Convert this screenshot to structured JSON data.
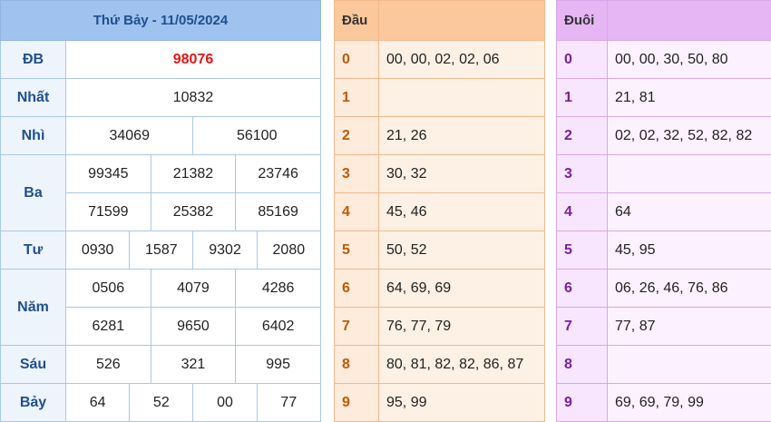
{
  "results": {
    "title": "Thứ Bảy - 11/05/2024",
    "labels": {
      "db": "ĐB",
      "nhat": "Nhất",
      "nhi": "Nhì",
      "ba": "Ba",
      "tu": "Tư",
      "nam": "Năm",
      "sau": "Sáu",
      "bay": "Bảy"
    },
    "db": "98076",
    "nhat": "10832",
    "nhi": [
      "34069",
      "56100"
    ],
    "ba": [
      "99345",
      "21382",
      "23746",
      "71599",
      "25382",
      "85169"
    ],
    "tu": [
      "0930",
      "1587",
      "9302",
      "2080"
    ],
    "nam": [
      "0506",
      "4079",
      "4286",
      "6281",
      "9650",
      "6402"
    ],
    "sau": [
      "526",
      "321",
      "995"
    ],
    "bay": [
      "64",
      "52",
      "00",
      "77"
    ]
  },
  "dau": {
    "header": "Đầu",
    "rows": [
      {
        "num": "0",
        "values": "00, 00, 02, 02, 06"
      },
      {
        "num": "1",
        "values": ""
      },
      {
        "num": "2",
        "values": "21, 26"
      },
      {
        "num": "3",
        "values": "30, 32"
      },
      {
        "num": "4",
        "values": "45, 46"
      },
      {
        "num": "5",
        "values": "50, 52"
      },
      {
        "num": "6",
        "values": "64, 69, 69"
      },
      {
        "num": "7",
        "values": "76, 77, 79"
      },
      {
        "num": "8",
        "values": "80, 81, 82, 82, 86, 87"
      },
      {
        "num": "9",
        "values": "95, 99"
      }
    ]
  },
  "duoi": {
    "header": "Đuôi",
    "rows": [
      {
        "num": "0",
        "values": "00, 00, 30, 50, 80"
      },
      {
        "num": "1",
        "values": "21, 81"
      },
      {
        "num": "2",
        "values": "02, 02, 32, 52, 82, 82"
      },
      {
        "num": "3",
        "values": ""
      },
      {
        "num": "4",
        "values": "64"
      },
      {
        "num": "5",
        "values": "45, 95"
      },
      {
        "num": "6",
        "values": "06, 26, 46, 76, 86"
      },
      {
        "num": "7",
        "values": "77, 87"
      },
      {
        "num": "8",
        "values": ""
      },
      {
        "num": "9",
        "values": "69, 69, 79, 99"
      }
    ]
  },
  "colors": {
    "special": "#e31515",
    "results_header": "#9fc3ee",
    "dau_header": "#fbc79d",
    "duoi_header": "#e6b5f3"
  }
}
